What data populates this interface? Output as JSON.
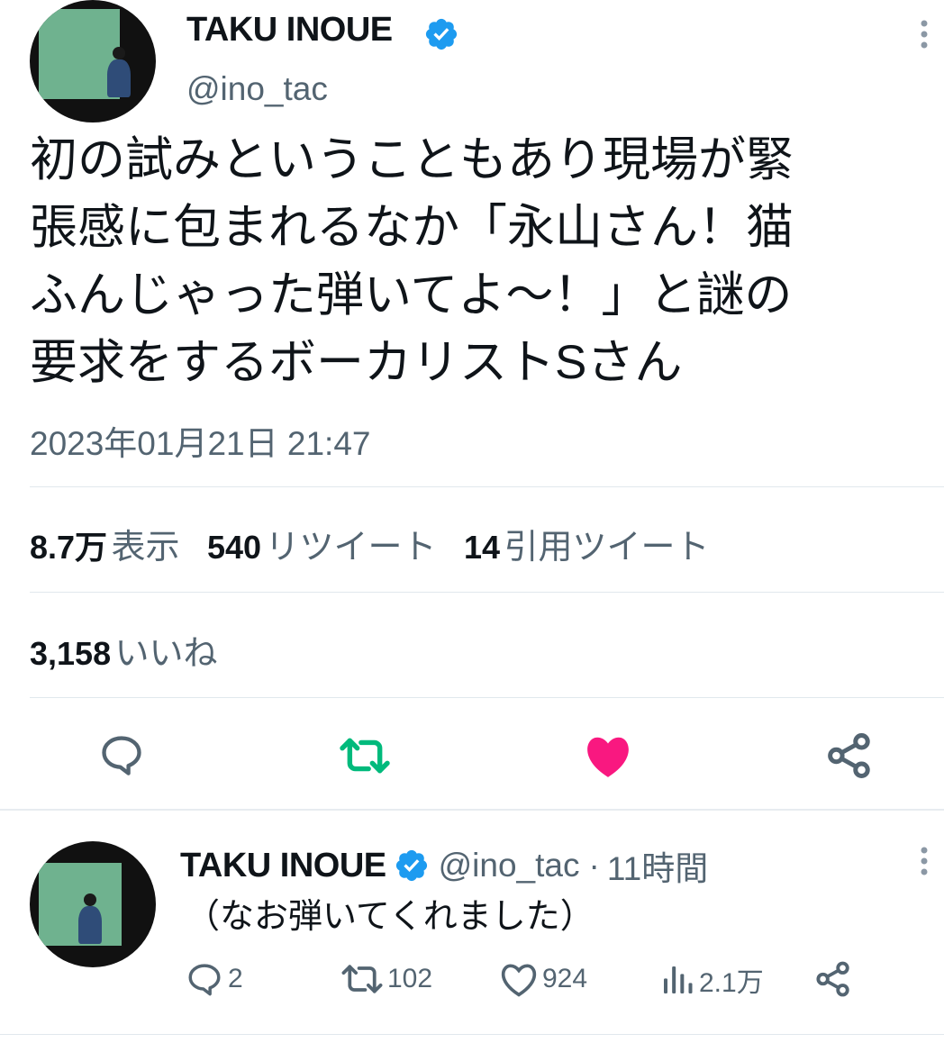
{
  "main_tweet": {
    "author_name": "TAKU INOUE",
    "handle": "@ino_tac",
    "text_lines": [
      "初の試みということもあり現場が緊",
      "張感に包まれるなか「永山さん！猫",
      "ふんじゃった弾いてよ〜！」と謎の",
      "要求をするボーカリストSさん"
    ],
    "timestamp": "2023年01月21日 21:47",
    "stats": {
      "views_count": "8.7万",
      "views_label": "表示",
      "retweets_count": "540",
      "retweets_label": "リツイート",
      "quotes_count": "14",
      "quotes_label": "引用ツイート",
      "likes_count": "3,158",
      "likes_label": "いいね"
    },
    "liked": true,
    "colors": {
      "like": "#f91880",
      "retweet": "#00ba7c",
      "verified": "#1d9bf0"
    }
  },
  "reply_tweet": {
    "author_name": "TAKU INOUE",
    "handle": "@ino_tac",
    "separator": "·",
    "time_ago": "11時間",
    "text": "（なお弾いてくれました）",
    "actions": {
      "replies": "2",
      "retweets": "102",
      "likes": "924",
      "views": "2.1万"
    }
  },
  "icons": [
    "more-icon",
    "verified-badge-icon",
    "reply-icon",
    "retweet-icon",
    "like-icon",
    "share-icon",
    "views-icon"
  ]
}
